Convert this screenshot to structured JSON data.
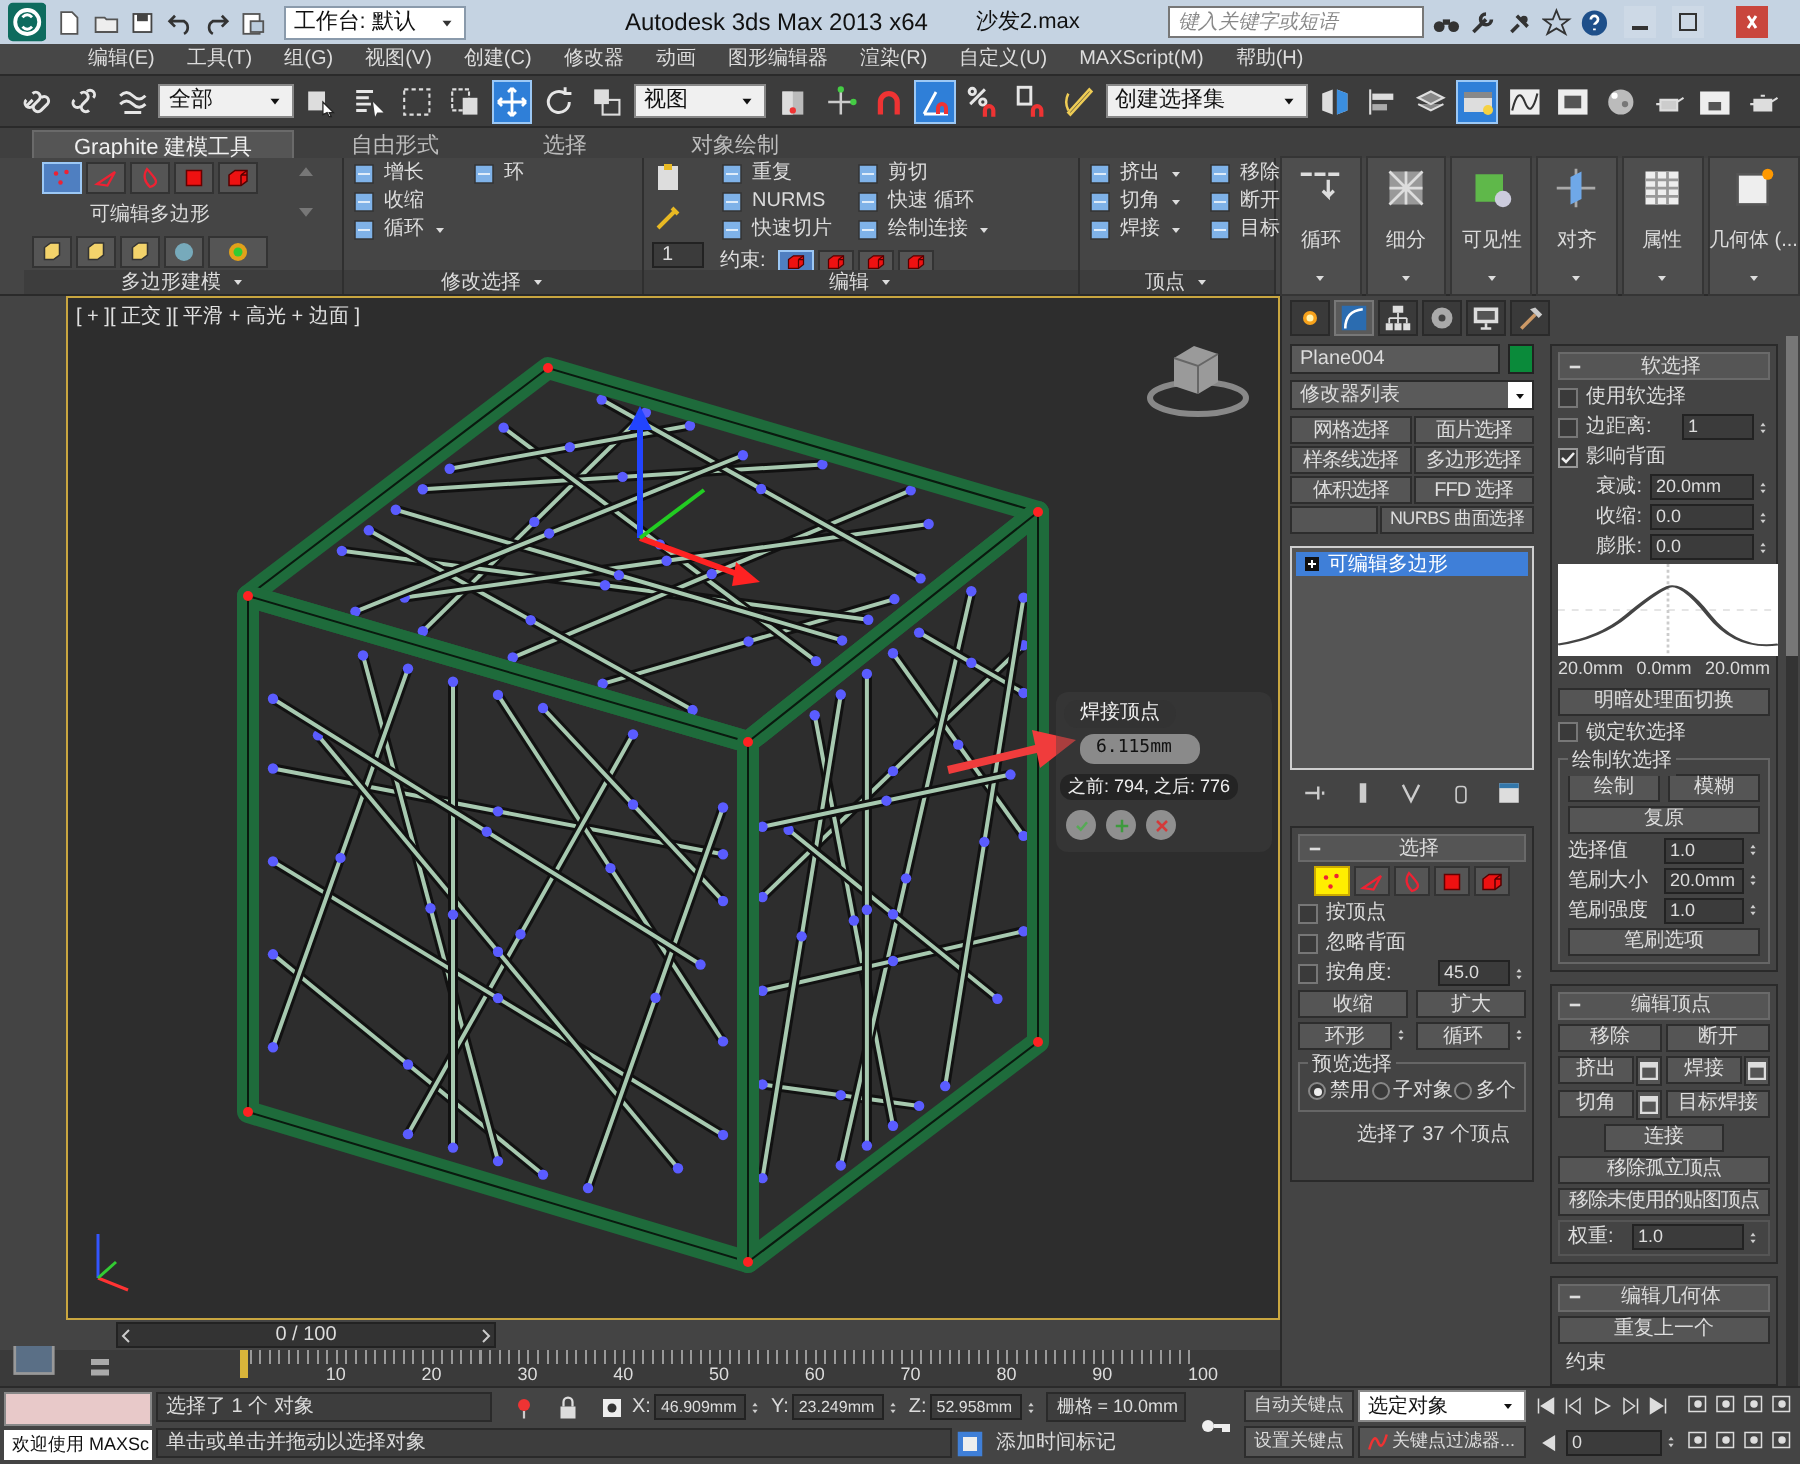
{
  "title_bar": {
    "workspace": "工作台: 默认",
    "app_title": "Autodesk 3ds Max  2013 x64",
    "file_name": "沙发2.max",
    "search": {
      "placeholder": "键入关键字或短语"
    }
  },
  "menu": [
    "编辑(E)",
    "工具(T)",
    "组(G)",
    "视图(V)",
    "创建(C)",
    "修改器",
    "动画",
    "图形编辑器",
    "渲染(R)",
    "自定义(U)",
    "MAXScript(M)",
    "帮助(H)"
  ],
  "toolbar": [
    {
      "kind": "link",
      "selected": false
    },
    {
      "kind": "unlink",
      "selected": false
    },
    {
      "kind": "bind",
      "selected": false
    },
    {
      "kind": "dropdown",
      "value": "全部"
    },
    {
      "kind": "select",
      "selected": false
    },
    {
      "kind": "select-name",
      "selected": false
    },
    {
      "kind": "region",
      "selected": false
    },
    {
      "kind": "crossing",
      "selected": false
    },
    {
      "kind": "move",
      "selected": true
    },
    {
      "kind": "rotate",
      "selected": false
    },
    {
      "kind": "scale",
      "selected": false
    },
    {
      "kind": "dropdown",
      "value": "视图"
    },
    {
      "kind": "pivot",
      "selected": false
    },
    {
      "kind": "manipulate",
      "selected": false
    },
    {
      "kind": "snap",
      "selected": false
    },
    {
      "kind": "angle-snap",
      "selected": true
    },
    {
      "kind": "percent-snap",
      "selected": false
    },
    {
      "kind": "spinner-snap",
      "selected": false
    },
    {
      "kind": "named-sets",
      "selected": false
    },
    {
      "kind": "dropdown",
      "value": "创建选择集"
    },
    {
      "kind": "mirror",
      "selected": false
    },
    {
      "kind": "align",
      "selected": false
    },
    {
      "kind": "layers",
      "selected": false
    },
    {
      "kind": "ribbon",
      "selected": true
    },
    {
      "kind": "curve-editor",
      "selected": false
    },
    {
      "kind": "schematic",
      "selected": false
    },
    {
      "kind": "material",
      "selected": false
    },
    {
      "kind": "render-setup",
      "selected": false
    },
    {
      "kind": "frame",
      "selected": false
    },
    {
      "kind": "render",
      "selected": false
    }
  ],
  "ribbon": {
    "tabs": [
      {
        "label": "Graphite 建模工具",
        "selected": true
      },
      {
        "label": "自由形式",
        "selected": false
      },
      {
        "label": "选择",
        "selected": false
      },
      {
        "label": "对象绘制",
        "selected": false
      }
    ],
    "groups": [
      {
        "kind": "polygon",
        "title": "多边形建模",
        "label": "可编辑多边形",
        "subobjects": [
          {
            "kind": "vertex",
            "selected": true
          },
          {
            "kind": "edge",
            "selected": false
          },
          {
            "kind": "border",
            "selected": false
          },
          {
            "kind": "polygon",
            "selected": false
          },
          {
            "kind": "element",
            "selected": false
          }
        ]
      },
      {
        "kind": "list",
        "title": "修改选择",
        "items": [
          {
            "label": "增长",
            "dropdown": false
          },
          {
            "label": "收缩",
            "dropdown": false
          },
          {
            "label": "循环",
            "dropdown": true
          },
          {
            "label": "环",
            "dropdown": false
          }
        ]
      },
      {
        "kind": "list",
        "title": "编辑",
        "spinner": "1",
        "items": [
          {
            "label": "重复",
            "dropdown": false
          },
          {
            "label": "NURMS",
            "dropdown": false
          },
          {
            "label": "快速切片",
            "dropdown": false
          },
          {
            "label": "剪切",
            "dropdown": false
          },
          {
            "label": "快速 循环",
            "dropdown": false
          },
          {
            "label": "绘制连接",
            "dropdown": true
          }
        ],
        "constraint_label": "约束:"
      },
      {
        "kind": "list",
        "title": "顶点",
        "items": [
          {
            "label": "挤出",
            "dropdown": true
          },
          {
            "label": "切角",
            "dropdown": true
          },
          {
            "label": "焊接",
            "dropdown": true
          },
          {
            "label": "移除",
            "dropdown": false
          },
          {
            "label": "断开",
            "dropdown": false
          },
          {
            "label": "目标",
            "dropdown": false
          }
        ]
      }
    ],
    "panels": [
      "循环",
      "细分",
      "可见性",
      "对齐",
      "属性",
      "几何体 (..."
    ]
  },
  "viewport": {
    "label": "[ + ][ 正交 ][ 平滑 + 高光 + 边面 ]",
    "caddy": {
      "title": "焊接顶点",
      "value": "6.115mm",
      "info": "之前: 794, 之后: 776"
    }
  },
  "command_panel": {
    "tabs": [
      {
        "kind": "create",
        "selected": false
      },
      {
        "kind": "modify",
        "selected": true
      },
      {
        "kind": "hierarchy",
        "selected": false
      },
      {
        "kind": "motion",
        "selected": false
      },
      {
        "kind": "display",
        "selected": false
      },
      {
        "kind": "utilities",
        "selected": false
      }
    ],
    "object_name": "Plane004",
    "modifier_list": "修改器列表",
    "modifier_buttons": [
      "网格选择",
      "面片选择",
      "样条线选择",
      "多边形选择",
      "体积选择",
      "FFD 选择",
      "NURBS 曲面选择"
    ],
    "stack": [
      {
        "label": "可编辑多边形",
        "selected": true
      }
    ],
    "selection": {
      "title": "选择",
      "subobjects": [
        {
          "kind": "vertex",
          "selected": true
        },
        {
          "kind": "edge",
          "selected": false
        },
        {
          "kind": "border",
          "selected": false
        },
        {
          "kind": "polygon",
          "selected": false
        },
        {
          "kind": "element",
          "selected": false
        }
      ],
      "checks": [
        {
          "label": "按顶点",
          "checked": false
        },
        {
          "label": "忽略背面",
          "checked": false
        },
        {
          "label": "按角度:",
          "checked": false,
          "value": "45.0"
        }
      ],
      "buttons": [
        "收缩",
        "扩大"
      ],
      "spin_buttons": [
        "环形",
        "循环"
      ],
      "preview": {
        "title": "预览选择",
        "options": [
          {
            "label": "禁用",
            "selected": true
          },
          {
            "label": "子对象",
            "selected": false
          },
          {
            "label": "多个",
            "selected": false
          }
        ]
      },
      "status": "选择了 37 个顶点"
    },
    "soft_selection": {
      "title": "软选择",
      "checks": [
        {
          "label": "使用软选择",
          "checked": false
        },
        {
          "label": "边距离:",
          "checked": false,
          "value": "1"
        },
        {
          "label": "影响背面",
          "checked": true
        }
      ],
      "fields": [
        {
          "label": "衰减:",
          "value": "20.0mm"
        },
        {
          "label": "收缩:",
          "value": "0.0"
        },
        {
          "label": "膨胀:",
          "value": "0.0"
        }
      ],
      "curve_labels": [
        "20.0mm",
        "0.0mm",
        "20.0mm"
      ],
      "shade_button": "明暗处理面切换",
      "lock": {
        "label": "锁定软选择",
        "checked": false
      },
      "paint": {
        "title": "绘制软选择",
        "buttons": [
          "绘制",
          "模糊"
        ],
        "revert": "复原",
        "fields": [
          {
            "label": "选择值",
            "value": "1.0"
          },
          {
            "label": "笔刷大小",
            "value": "20.0mm"
          },
          {
            "label": "笔刷强度",
            "value": "1.0"
          }
        ],
        "options": "笔刷选项"
      }
    },
    "edit_vertices": {
      "title": "编辑顶点",
      "buttons": [
        {
          "label": "移除",
          "kind": "plain"
        },
        {
          "label": "断开",
          "kind": "plain"
        },
        {
          "label": "挤出",
          "kind": "settings"
        },
        {
          "label": "焊接",
          "kind": "settings"
        },
        {
          "label": "切角",
          "kind": "settings"
        },
        {
          "label": "目标焊接",
          "kind": "plain"
        },
        {
          "label": "连接",
          "kind": "small"
        },
        {
          "label": "移除孤立顶点",
          "kind": "wide"
        },
        {
          "label": "移除未使用的贴图顶点",
          "kind": "wide"
        }
      ],
      "weight": {
        "label": "权重:",
        "value": "1.0"
      }
    },
    "edit_geometry": {
      "title": "编辑几何体",
      "button": "重复上一个",
      "group": "约束"
    }
  },
  "timeline": {
    "position": "0 / 100",
    "ruler_labels": [
      "10",
      "20",
      "30",
      "40",
      "50",
      "60",
      "70",
      "80",
      "90",
      "100"
    ]
  },
  "status_bar": {
    "welcome": "欢迎使用 MAXSc",
    "selection": "选择了 1 个 对象",
    "prompt": "单击或单击并拖动以选择对象",
    "coords": [
      {
        "axis": "X:",
        "value": "46.909mm"
      },
      {
        "axis": "Y:",
        "value": "23.249mm"
      },
      {
        "axis": "Z:",
        "value": "52.958mm"
      }
    ],
    "grid": "栅格 = 10.0mm",
    "time_tag": "添加时间标记",
    "auto_key": "自动关键点",
    "set_key": "设置关键点",
    "key_mode": "选定对象",
    "key_filters": "关键点过滤器...",
    "frame": "0"
  }
}
